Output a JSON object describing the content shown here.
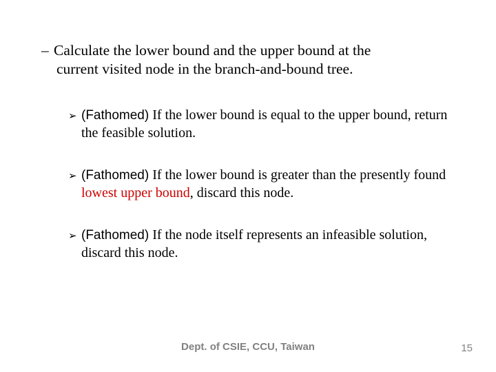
{
  "main": {
    "dash": "–",
    "text_line1": "Calculate the lower bound and the upper bound at the",
    "text_line2": "current visited node in the branch-and-bound tree."
  },
  "items": [
    {
      "arrow": "➢",
      "label": "(Fathomed)",
      "rest": " If the lower bound is equal to the upper bound, return the feasible solution."
    },
    {
      "arrow": "➢",
      "label": "(Fathomed)",
      "rest_a": " If the lower bound is greater than the presently found ",
      "red": "lowest upper bound",
      "rest_b": ", discard this node."
    },
    {
      "arrow": "➢",
      "label": "(Fathomed)",
      "rest": " If the node itself represents an infeasible solution, discard this node."
    }
  ],
  "footer": "Dept. of CSIE, CCU, Taiwan",
  "page": "15"
}
